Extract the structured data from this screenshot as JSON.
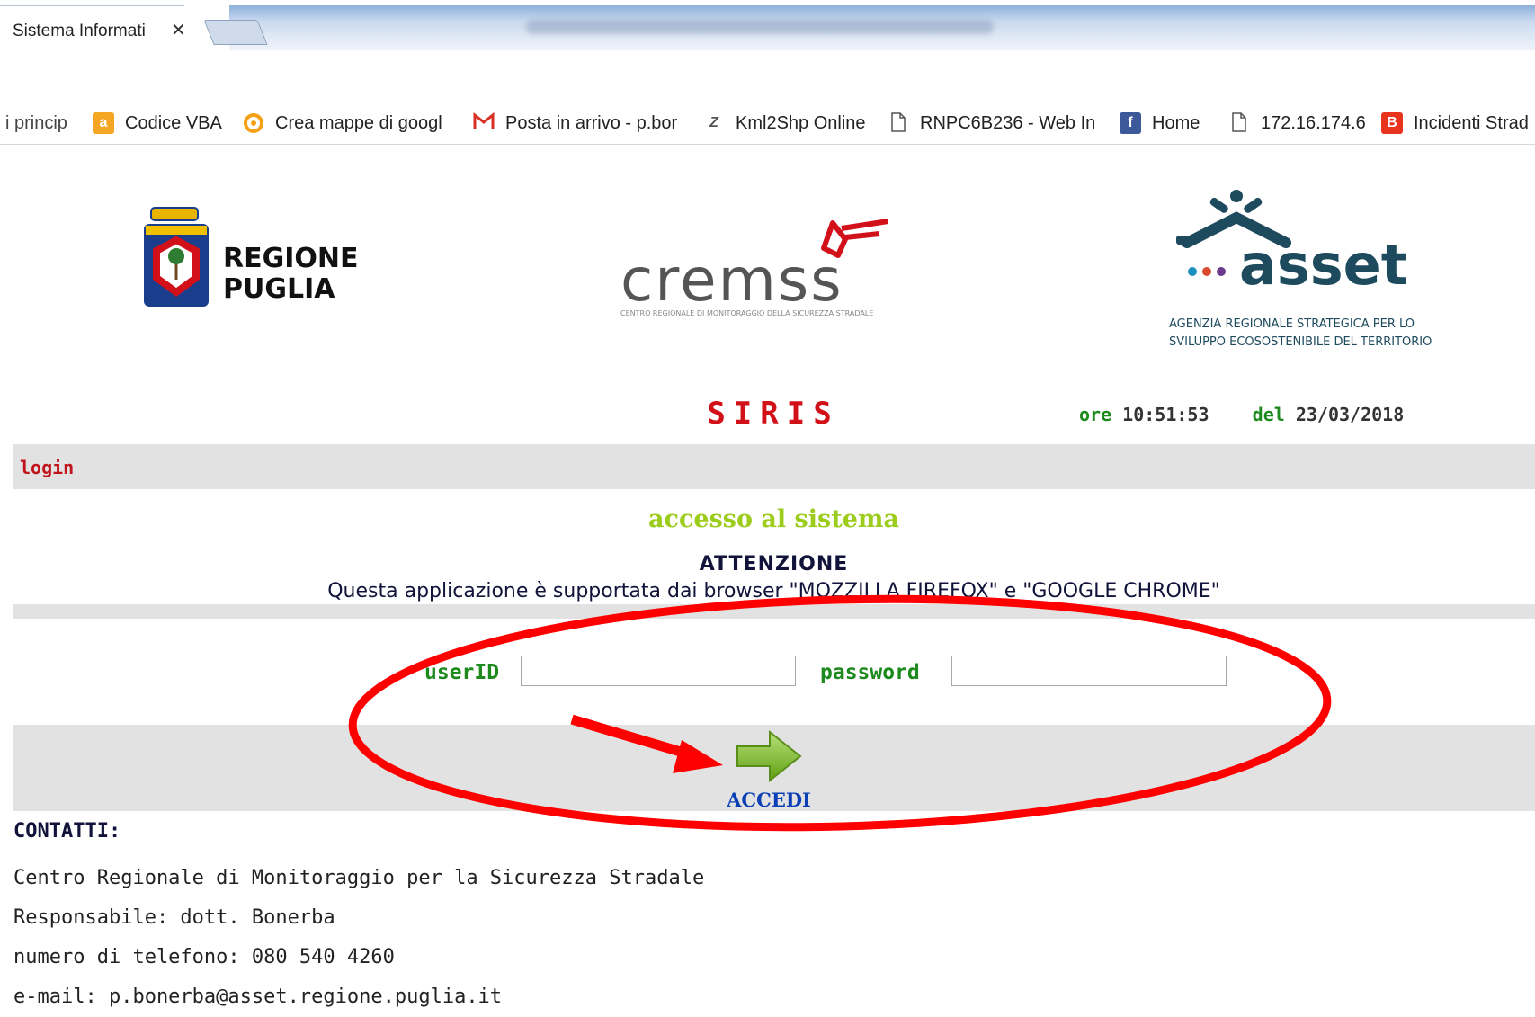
{
  "browser": {
    "tab_title": "Sistema Informati",
    "tab_close": "✕"
  },
  "bookmarks": [
    {
      "label": "i princip",
      "icon": "page-icon"
    },
    {
      "label": "Codice VBA",
      "icon": "amazon-icon"
    },
    {
      "label": "Crea mappe di googl",
      "icon": "mymaps-icon"
    },
    {
      "label": "Posta in arrivo - p.bor",
      "icon": "gmail-icon"
    },
    {
      "label": "Kml2Shp Online",
      "icon": "z-logo-icon"
    },
    {
      "label": "RNPC6B236 - Web In",
      "icon": "page-icon"
    },
    {
      "label": "Home",
      "icon": "facebook-icon"
    },
    {
      "label": "172.16.174.6",
      "icon": "page-icon"
    },
    {
      "label": "Incidenti Strad",
      "icon": "blogger-icon"
    }
  ],
  "logos": {
    "regione_line1": "REGIONE",
    "regione_line2": "PUGLIA",
    "cremss": "cremss",
    "cremss_sub": "CENTRO REGIONALE DI MONITORAGGIO DELLA SICUREZZA STRADALE",
    "asset": "asset",
    "asset_sub1": "AGENZIA REGIONALE STRATEGICA PER LO",
    "asset_sub2": "SVILUPPO ECOSOSTENIBILE DEL TERRITORIO"
  },
  "header": {
    "app_name": "SIRIS",
    "time_prefix": "ore",
    "time": "10:51:53",
    "date_prefix": "del",
    "date": "23/03/2018"
  },
  "breadcrumb": "login",
  "access": {
    "title": "accesso al sistema",
    "attention": "ATTENZIONE",
    "support_note": "Questa applicazione è supportata dai browser \"MOZZILLA FIREFOX\" e \"GOOGLE CHROME\""
  },
  "form": {
    "user_label": "userID",
    "user_value": "",
    "password_label": "password",
    "password_value": "",
    "submit_label": "ACCEDI"
  },
  "contacts": {
    "heading": "CONTATTI:",
    "lines": [
      "Centro Regionale di Monitoraggio per la Sicurezza Stradale",
      "Responsabile: dott. Bonerba",
      "numero di telefono: 080 540 4260",
      "e-mail: p.bonerba@asset.regione.puglia.it"
    ]
  },
  "colors": {
    "accent_red": "#d21018",
    "label_green": "#1c8a1c",
    "title_lime": "#9ccc1c",
    "link_blue": "#0a3fb5",
    "annotation_red": "#ff0000"
  }
}
